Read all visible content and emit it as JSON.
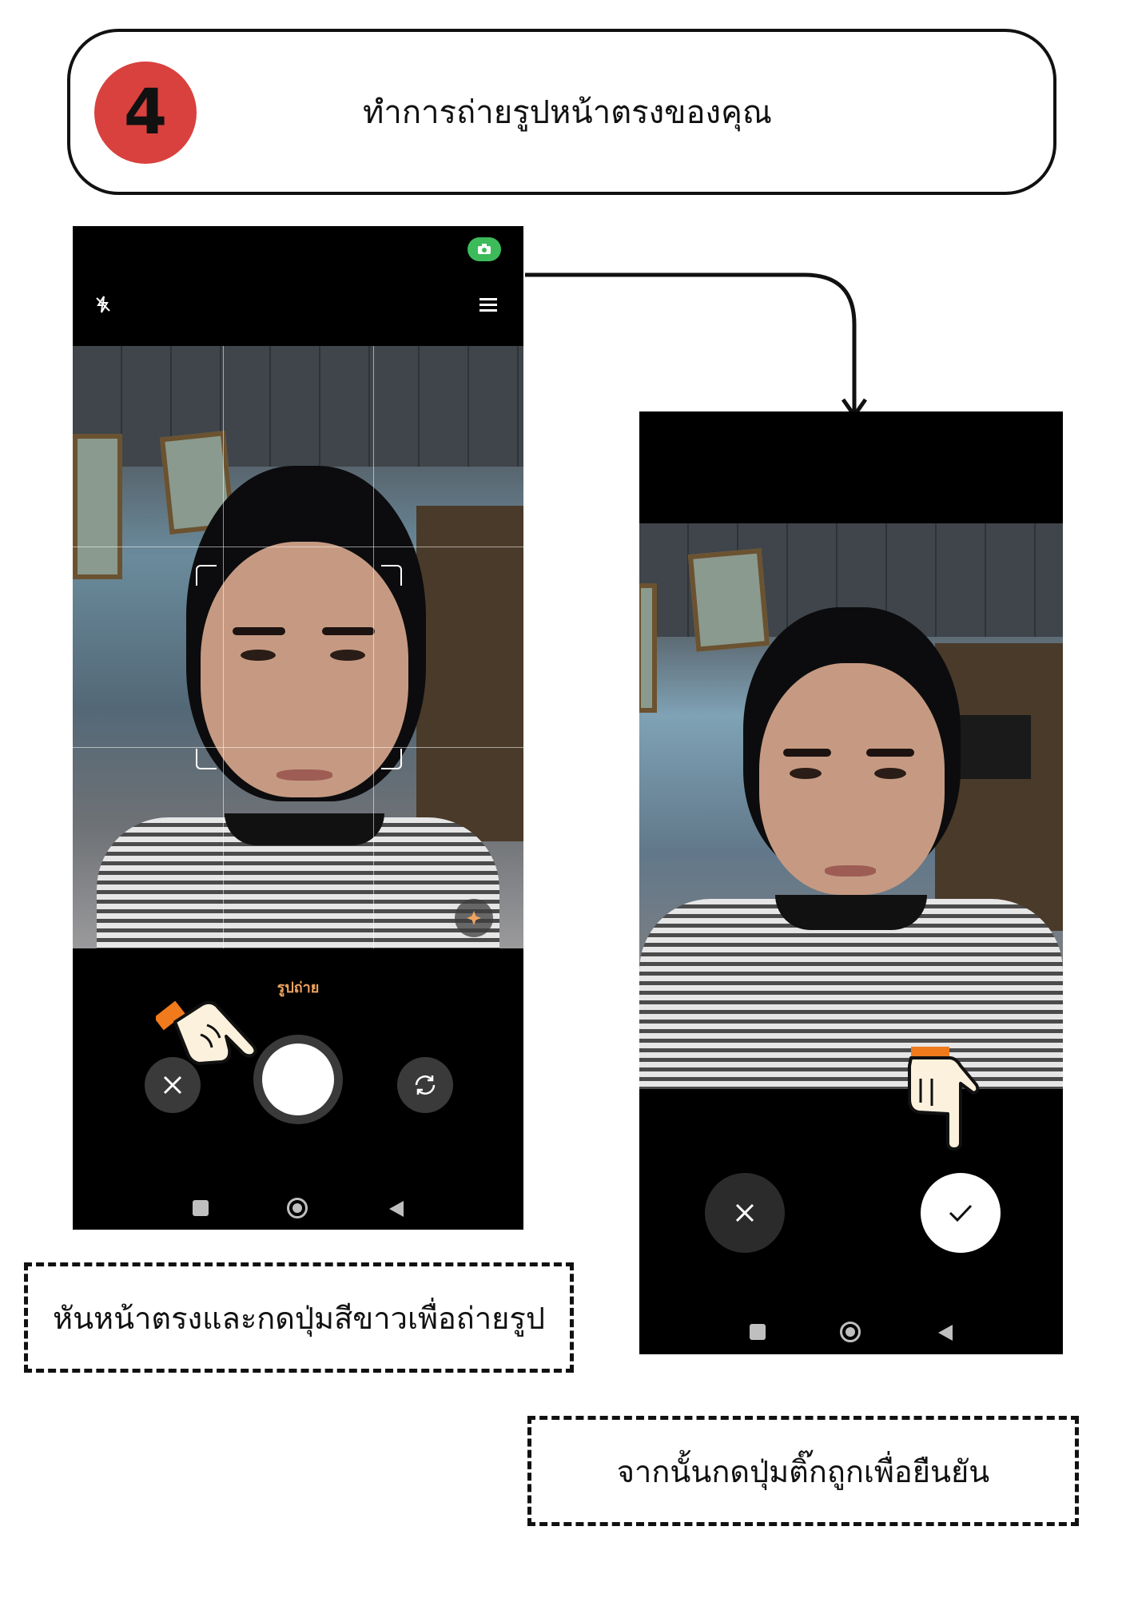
{
  "header": {
    "step_number": "4",
    "title": "ทำการถ่ายรูปหน้าตรงของคุณ"
  },
  "camera_screen": {
    "mode_label": "รูปถ่าย",
    "icons": [
      "flash-off-icon",
      "menu-icon",
      "camera-indicator-icon",
      "ai-scene-icon",
      "close-icon",
      "shutter-icon",
      "switch-camera-icon"
    ]
  },
  "confirm_screen": {
    "icons": [
      "close-icon",
      "check-icon"
    ]
  },
  "captions": {
    "left": "หันหน้าตรงและกดปุ่มสีขาวเพื่อถ่ายรูป",
    "right": "จากนั้นกดปุ่มติ๊กถูกเพื่อยืนยัน"
  },
  "colors": {
    "badge": "#d9413e",
    "camera_indicator": "#3dbb5a",
    "mode_label": "#f0a35e",
    "pointer_cuff": "#f07a1c"
  }
}
